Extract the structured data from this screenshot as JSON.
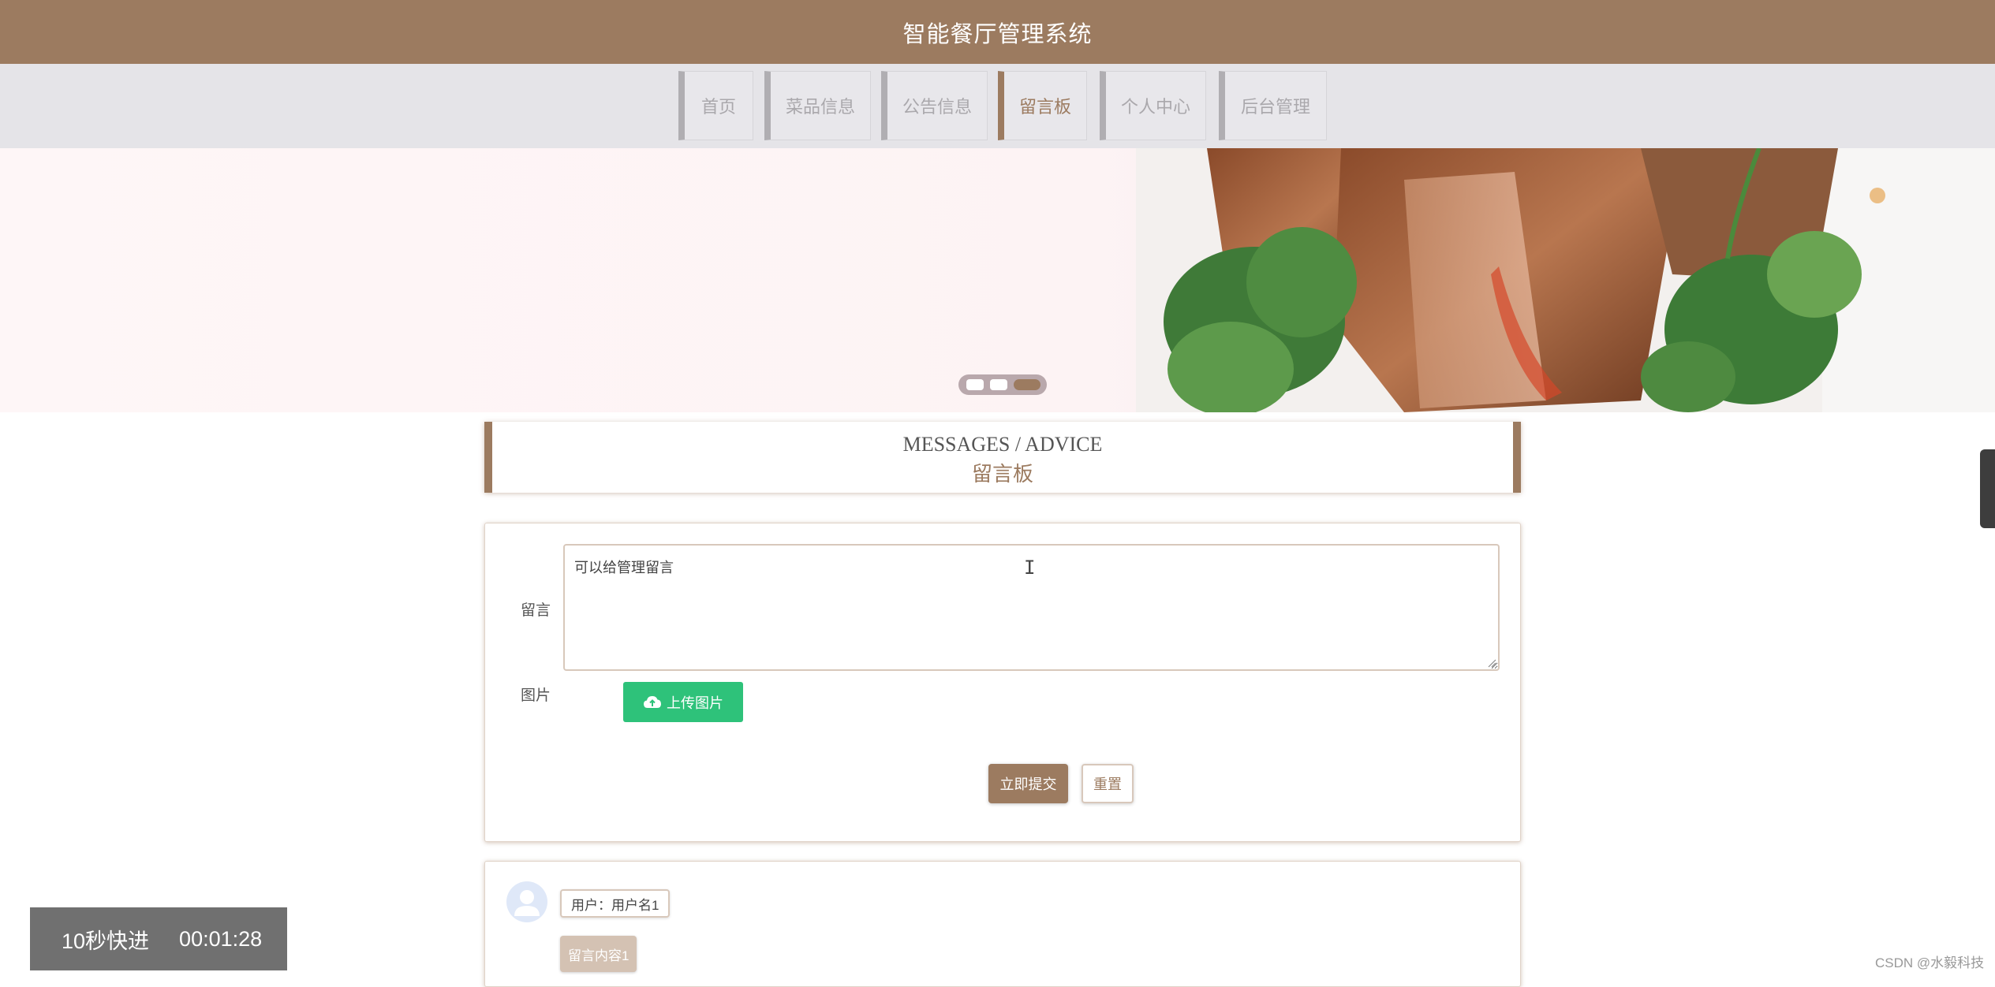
{
  "header": {
    "title": "智能餐厅管理系统"
  },
  "nav": {
    "items": [
      {
        "label": "首页",
        "active": false
      },
      {
        "label": "菜品信息",
        "active": false
      },
      {
        "label": "公告信息",
        "active": false
      },
      {
        "label": "留言板",
        "active": true
      },
      {
        "label": "个人中心",
        "active": false
      },
      {
        "label": "后台管理",
        "active": false
      }
    ]
  },
  "banner": {
    "slide_count": 3,
    "active_slide": 3
  },
  "section": {
    "title_en": "MESSAGES / ADVICE",
    "title_cn": "留言板"
  },
  "form": {
    "message_label": "留言",
    "message_value": "可以给管理留言",
    "image_label": "图片",
    "upload_label": "上传图片",
    "submit_label": "立即提交",
    "reset_label": "重置"
  },
  "messages": [
    {
      "user": "用户：用户名1",
      "content": "留言内容1"
    }
  ],
  "video": {
    "skip_label": "10秒快进",
    "time": "00:01:28"
  },
  "watermark": "CSDN @水毅科技",
  "colors": {
    "brand": "#9c7b60",
    "upload": "#2ec27a",
    "nav_bg": "#e5e4e8"
  }
}
